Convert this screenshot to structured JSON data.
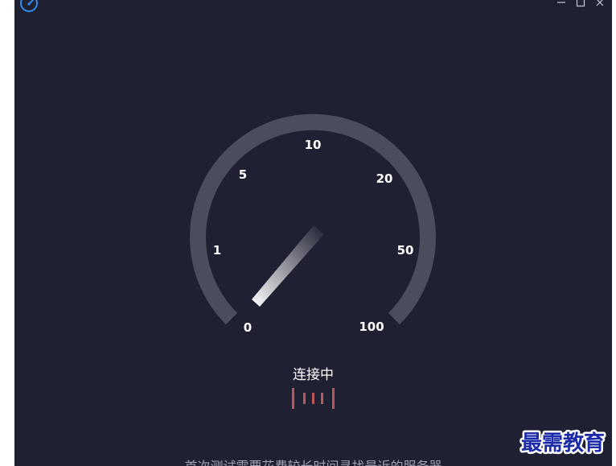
{
  "window": {
    "app_icon": "speedometer-icon",
    "controls": [
      "minimize-icon",
      "maximize-icon",
      "close-icon"
    ],
    "accent": "#2f8cf0",
    "background": "#1f2032"
  },
  "gauge": {
    "tick_labels": [
      "0",
      "1",
      "5",
      "10",
      "20",
      "50",
      "100"
    ],
    "needle_value": "0",
    "arc_color": "#4b4d5c"
  },
  "status": {
    "label": "连接中",
    "loader_color": "#b9585a"
  },
  "hint": {
    "text": "首次测试需要花费较长时间寻找最近的服务器"
  },
  "watermark": {
    "text": "最需教育",
    "color": "#1a2aa8"
  }
}
